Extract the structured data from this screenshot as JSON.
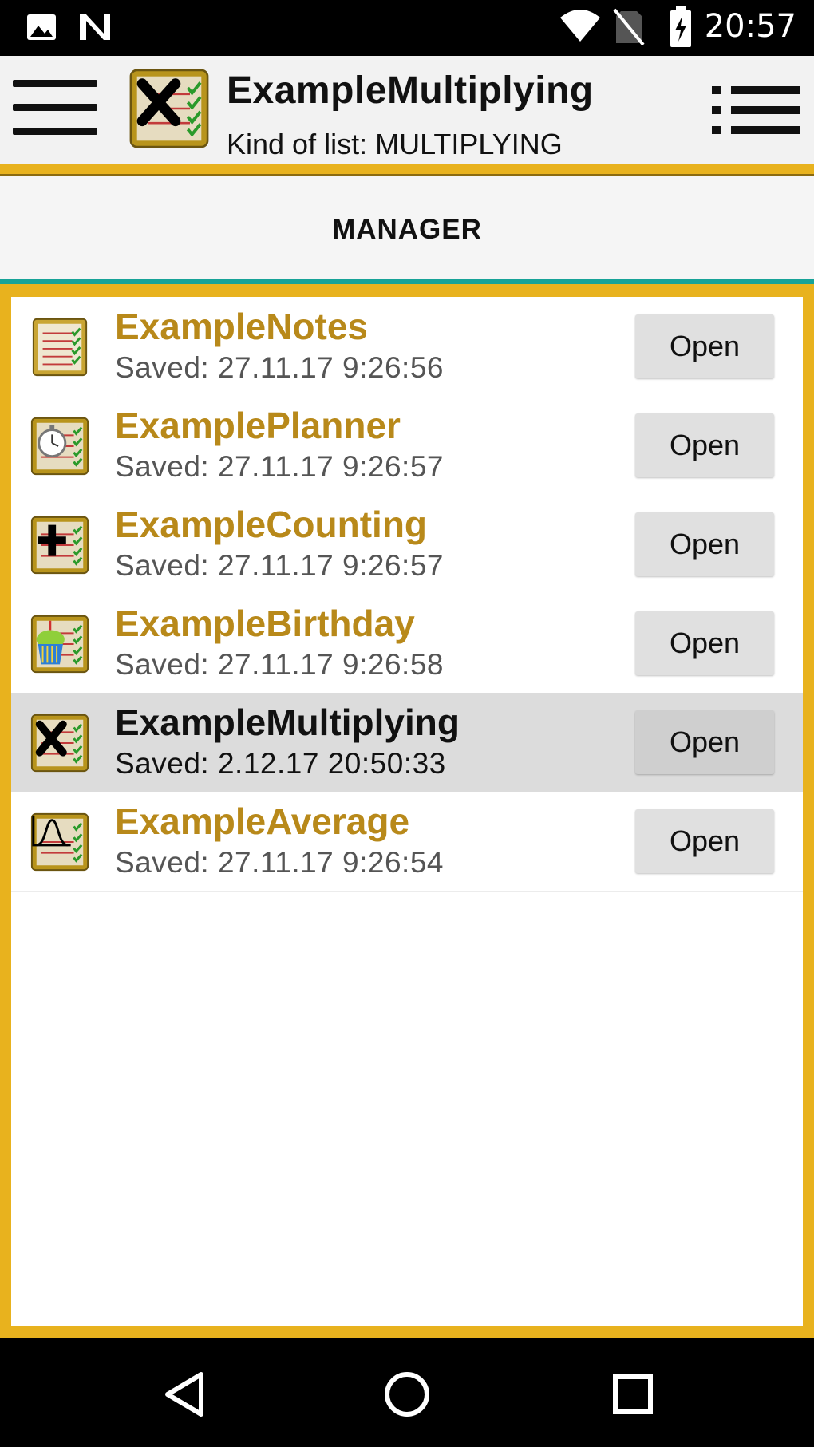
{
  "status_bar": {
    "time": "20:57",
    "icons": [
      "image-icon",
      "n-icon",
      "wifi-icon",
      "no-sim-icon",
      "battery-charging-icon"
    ]
  },
  "app_bar": {
    "title": "ExampleMultiplying",
    "subtitle": "Kind of list: MULTIPLYING",
    "app_icon": "multiply-list-icon"
  },
  "tab": {
    "label": "MANAGER"
  },
  "colors": {
    "accent": "#e8b21e",
    "tab_indicator": "#17a398",
    "item_title": "#b8891a"
  },
  "lists": [
    {
      "name": "ExampleNotes",
      "saved": "Saved: 27.11.17 9:26:56",
      "button": "Open",
      "icon": "notes-list-icon",
      "selected": false
    },
    {
      "name": "ExamplePlanner",
      "saved": "Saved: 27.11.17 9:26:57",
      "button": "Open",
      "icon": "stopwatch-list-icon",
      "selected": false
    },
    {
      "name": "ExampleCounting",
      "saved": "Saved: 27.11.17 9:26:57",
      "button": "Open",
      "icon": "plus-list-icon",
      "selected": false
    },
    {
      "name": "ExampleBirthday",
      "saved": "Saved: 27.11.17 9:26:58",
      "button": "Open",
      "icon": "cake-list-icon",
      "selected": false
    },
    {
      "name": "ExampleMultiplying",
      "saved": "Saved: 2.12.17 20:50:33",
      "button": "Open",
      "icon": "multiply-list-icon",
      "selected": true
    },
    {
      "name": "ExampleAverage",
      "saved": "Saved: 27.11.17 9:26:54",
      "button": "Open",
      "icon": "bell-curve-list-icon",
      "selected": false
    }
  ],
  "nav": [
    "back-icon",
    "home-icon",
    "recents-icon"
  ]
}
